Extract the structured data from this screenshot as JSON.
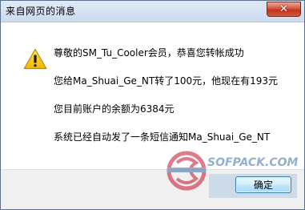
{
  "window": {
    "title": "来自网页的消息",
    "close_glyph": "✕"
  },
  "message": {
    "icon": "warning-icon",
    "lines": [
      "尊敬的SM_Tu_Cooler会员，恭喜您转帐成功",
      "您给Ma_Shuai_Ge_NT转了100元，他现在有193元",
      "您目前账户的余额为6384元",
      "系统已经自动发了一条短信通知Ma_Shuai_Ge_NT"
    ]
  },
  "buttons": {
    "ok_label": "确定"
  },
  "watermark": {
    "text": "SOFPACK.COM"
  },
  "colors": {
    "titlebar": "#cddbef",
    "close_button": "#c3331b",
    "warning": "#f2c200",
    "ok_border": "#3c7fb1"
  }
}
